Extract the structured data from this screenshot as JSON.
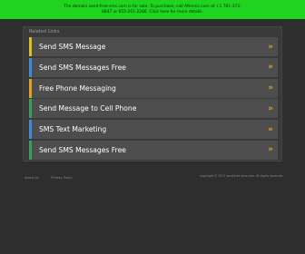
{
  "banner": {
    "text": "The domain send-free-sms.com is for sale. To purchase, call Afternic.com at +1 781-373-6847 or 855-201-2286. Click here for more details."
  },
  "panel": {
    "label": "Related Links",
    "accent_colors": [
      "#dcbf1e",
      "#3d8ed8",
      "#e0a020",
      "#36a060",
      "#3d8ed8",
      "#36a060"
    ],
    "links": [
      {
        "label": "Send SMS Message",
        "arrow": "»"
      },
      {
        "label": "Send SMS Messages Free",
        "arrow": "»"
      },
      {
        "label": "Free Phone Messaging",
        "arrow": "»"
      },
      {
        "label": "Send Message to Cell Phone",
        "arrow": "»"
      },
      {
        "label": "SMS Text Marketing",
        "arrow": "»"
      },
      {
        "label": "Send SMS Messages Free",
        "arrow": "»"
      }
    ]
  },
  "footer": {
    "about": "About Us",
    "privacy": "Privacy Policy",
    "copyright": "copyright © 2017 send-free-sms.com. All rights reserved."
  }
}
